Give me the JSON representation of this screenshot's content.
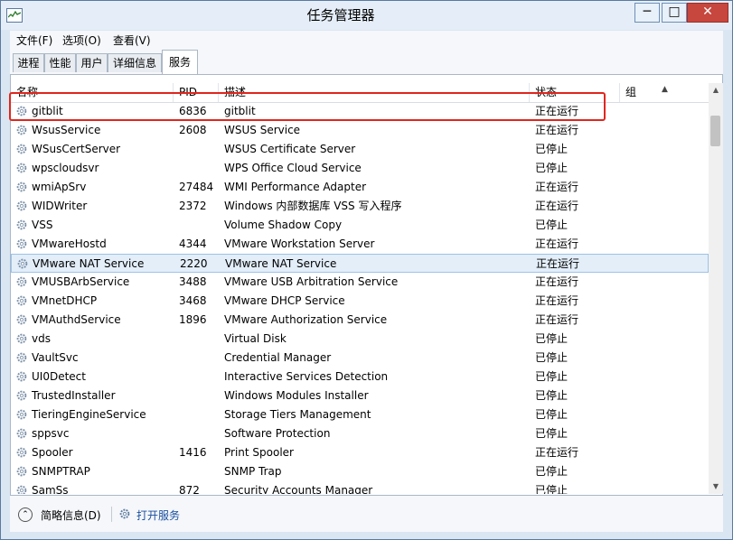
{
  "window": {
    "title": "任务管理器"
  },
  "menu": {
    "file": "文件(F)",
    "options": "选项(O)",
    "view": "查看(V)"
  },
  "tabs": [
    {
      "label": "进程"
    },
    {
      "label": "性能"
    },
    {
      "label": "用户"
    },
    {
      "label": "详细信息"
    },
    {
      "label": "服务",
      "active": true
    }
  ],
  "table": {
    "columns": {
      "name": "名称",
      "pid": "PID",
      "description": "描述",
      "status": "状态",
      "group": "组"
    },
    "rows": [
      {
        "name": "gitblit",
        "pid": "6836",
        "description": "gitblit",
        "status": "正在运行"
      },
      {
        "name": "WsusService",
        "pid": "2608",
        "description": "WSUS Service",
        "status": "正在运行"
      },
      {
        "name": "WSusCertServer",
        "pid": "",
        "description": "WSUS Certificate Server",
        "status": "已停止"
      },
      {
        "name": "wpscloudsvr",
        "pid": "",
        "description": "WPS Office Cloud Service",
        "status": "已停止"
      },
      {
        "name": "wmiApSrv",
        "pid": "27484",
        "description": "WMI Performance Adapter",
        "status": "正在运行"
      },
      {
        "name": "WIDWriter",
        "pid": "2372",
        "description": "Windows 内部数据库 VSS 写入程序",
        "status": "正在运行"
      },
      {
        "name": "VSS",
        "pid": "",
        "description": "Volume Shadow Copy",
        "status": "已停止"
      },
      {
        "name": "VMwareHostd",
        "pid": "4344",
        "description": "VMware Workstation Server",
        "status": "正在运行"
      },
      {
        "name": "VMware NAT Service",
        "pid": "2220",
        "description": "VMware NAT Service",
        "status": "正在运行",
        "selected": true
      },
      {
        "name": "VMUSBArbService",
        "pid": "3488",
        "description": "VMware USB Arbitration Service",
        "status": "正在运行"
      },
      {
        "name": "VMnetDHCP",
        "pid": "3468",
        "description": "VMware DHCP Service",
        "status": "正在运行"
      },
      {
        "name": "VMAuthdService",
        "pid": "1896",
        "description": "VMware Authorization Service",
        "status": "正在运行"
      },
      {
        "name": "vds",
        "pid": "",
        "description": "Virtual Disk",
        "status": "已停止"
      },
      {
        "name": "VaultSvc",
        "pid": "",
        "description": "Credential Manager",
        "status": "已停止"
      },
      {
        "name": "UI0Detect",
        "pid": "",
        "description": "Interactive Services Detection",
        "status": "已停止"
      },
      {
        "name": "TrustedInstaller",
        "pid": "",
        "description": "Windows Modules Installer",
        "status": "已停止"
      },
      {
        "name": "TieringEngineService",
        "pid": "",
        "description": "Storage Tiers Management",
        "status": "已停止"
      },
      {
        "name": "sppsvc",
        "pid": "",
        "description": "Software Protection",
        "status": "已停止"
      },
      {
        "name": "Spooler",
        "pid": "1416",
        "description": "Print Spooler",
        "status": "正在运行"
      },
      {
        "name": "SNMPTRAP",
        "pid": "",
        "description": "SNMP Trap",
        "status": "已停止"
      },
      {
        "name": "SamSs",
        "pid": "872",
        "description": "Security Accounts Manager",
        "status": "已停止"
      }
    ]
  },
  "footer": {
    "fewer_details": "简略信息(D)",
    "open_services": "打开服务"
  },
  "colors": {
    "highlight_box": "#e0261d",
    "selected_row": "#e3eef9"
  }
}
